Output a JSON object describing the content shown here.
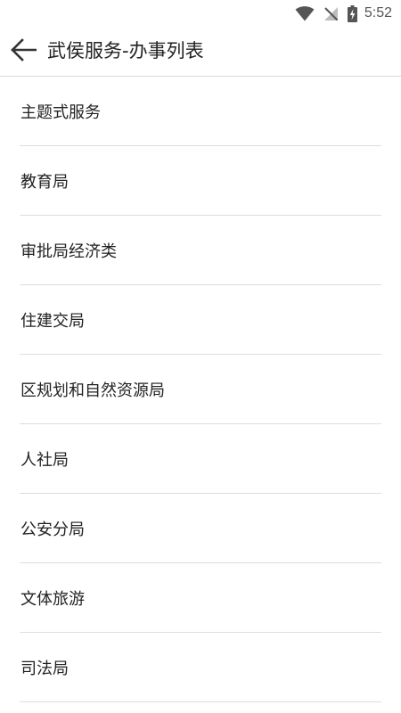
{
  "status_bar": {
    "time": "5:52",
    "icons": [
      "wifi-icon",
      "no-sim-signal-icon",
      "battery-charging-icon"
    ]
  },
  "header": {
    "back_icon": "arrow-left-icon",
    "title": "武侯服务-办事列表"
  },
  "list": {
    "items": [
      {
        "label": "主题式服务"
      },
      {
        "label": "教育局"
      },
      {
        "label": "审批局经济类"
      },
      {
        "label": "住建交局"
      },
      {
        "label": "区规划和自然资源局"
      },
      {
        "label": "人社局"
      },
      {
        "label": "公安分局"
      },
      {
        "label": "文体旅游"
      },
      {
        "label": "司法局"
      }
    ]
  },
  "colors": {
    "background": "#ffffff",
    "text": "#222222",
    "divider": "#dddddd",
    "status_icons": "#555555"
  }
}
